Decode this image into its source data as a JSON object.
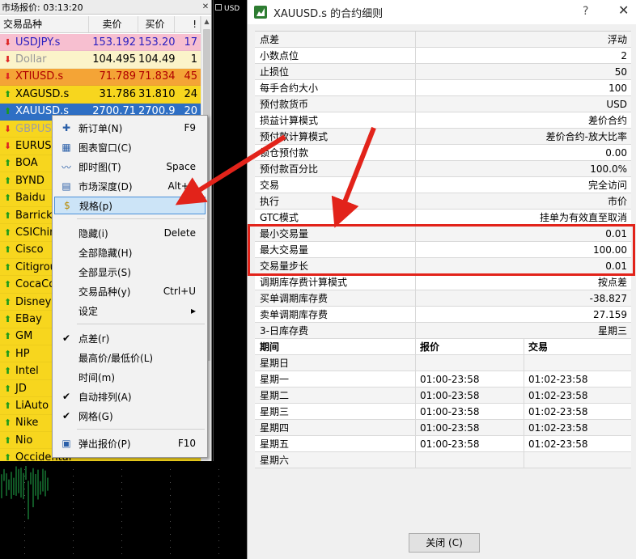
{
  "market_watch": {
    "title": "市场报价: 03:13:20",
    "close_glyph": "✕",
    "headers": {
      "symbol": "交易品种",
      "bid": "卖价",
      "ask": "买价",
      "spread": "!"
    },
    "rows": [
      {
        "symbol": "USDJPY.s",
        "bid": "153.192",
        "ask": "153.209",
        "spread": "17",
        "dir": "down",
        "bg": "#f7bfd0",
        "color": "#2a1fc0"
      },
      {
        "symbol": "Dollar",
        "bid": "104.495",
        "ask": "104.496",
        "spread": "1",
        "dir": "down",
        "bg": "#fbf3c9",
        "color": "#999999",
        "bidColor": "#000000"
      },
      {
        "symbol": "XTIUSD.s",
        "bid": "71.789",
        "ask": "71.834",
        "spread": "45",
        "dir": "down",
        "bg": "#f4a436",
        "color": "#b00000"
      },
      {
        "symbol": "XAGUSD.s",
        "bid": "31.786",
        "ask": "31.810",
        "spread": "24",
        "dir": "up",
        "bg": "#f7d61e",
        "color": "#000000"
      },
      {
        "symbol": "XAUUSD.s",
        "bid": "2700.71",
        "ask": "2700.91",
        "spread": "20",
        "dir": "up",
        "bg": "#2e6fc4",
        "color": "#ffffff"
      },
      {
        "symbol": "GBPUSD.s",
        "bid": "",
        "ask": "",
        "spread": "",
        "dir": "down",
        "bg": "#f7d61e",
        "color": "#a0a0a0"
      },
      {
        "symbol": "EURUSD.s",
        "bid": "",
        "ask": "",
        "spread": "",
        "dir": "down",
        "bg": "#f7d61e",
        "color": "#000000"
      },
      {
        "symbol": "BOA",
        "bid": "",
        "ask": "",
        "spread": "",
        "dir": "up",
        "bg": "#f7d61e",
        "color": "#000000"
      },
      {
        "symbol": "BYND",
        "bid": "",
        "ask": "",
        "spread": "",
        "dir": "up",
        "bg": "#f7d61e",
        "color": "#000000"
      },
      {
        "symbol": "Baidu",
        "bid": "",
        "ask": "",
        "spread": "",
        "dir": "up",
        "bg": "#f7d61e",
        "color": "#000000"
      },
      {
        "symbol": "Barrick",
        "bid": "",
        "ask": "",
        "spread": "",
        "dir": "up",
        "bg": "#f7d61e",
        "color": "#000000"
      },
      {
        "symbol": "CSIChina",
        "bid": "",
        "ask": "",
        "spread": "",
        "dir": "up",
        "bg": "#f7d61e",
        "color": "#000000"
      },
      {
        "symbol": "Cisco",
        "bid": "",
        "ask": "",
        "spread": "",
        "dir": "up",
        "bg": "#f7d61e",
        "color": "#000000"
      },
      {
        "symbol": "Citigroup",
        "bid": "",
        "ask": "",
        "spread": "",
        "dir": "up",
        "bg": "#f7d61e",
        "color": "#000000"
      },
      {
        "symbol": "CocaCola",
        "bid": "",
        "ask": "",
        "spread": "",
        "dir": "up",
        "bg": "#f7d61e",
        "color": "#000000"
      },
      {
        "symbol": "Disney",
        "bid": "",
        "ask": "",
        "spread": "",
        "dir": "up",
        "bg": "#f7d61e",
        "color": "#000000"
      },
      {
        "symbol": "EBay",
        "bid": "",
        "ask": "",
        "spread": "",
        "dir": "up",
        "bg": "#f7d61e",
        "color": "#000000"
      },
      {
        "symbol": "GM",
        "bid": "",
        "ask": "",
        "spread": "",
        "dir": "up",
        "bg": "#f7d61e",
        "color": "#000000"
      },
      {
        "symbol": "HP",
        "bid": "",
        "ask": "",
        "spread": "",
        "dir": "up",
        "bg": "#f7d61e",
        "color": "#000000"
      },
      {
        "symbol": "Intel",
        "bid": "",
        "ask": "",
        "spread": "",
        "dir": "up",
        "bg": "#f7d61e",
        "color": "#000000"
      },
      {
        "symbol": "JD",
        "bid": "",
        "ask": "",
        "spread": "",
        "dir": "up",
        "bg": "#f7d61e",
        "color": "#000000"
      },
      {
        "symbol": "LiAuto",
        "bid": "",
        "ask": "",
        "spread": "",
        "dir": "up",
        "bg": "#f7d61e",
        "color": "#000000"
      },
      {
        "symbol": "Nike",
        "bid": "",
        "ask": "",
        "spread": "",
        "dir": "up",
        "bg": "#f7d61e",
        "color": "#000000"
      },
      {
        "symbol": "Nio",
        "bid": "",
        "ask": "",
        "spread": "",
        "dir": "up",
        "bg": "#f7d61e",
        "color": "#000000"
      },
      {
        "symbol": "Occidental",
        "bid": "",
        "ask": "",
        "spread": "",
        "dir": "up",
        "bg": "#f7d61e",
        "color": "#000000"
      }
    ]
  },
  "chart": {
    "label": "USD"
  },
  "context_menu": {
    "items": [
      {
        "label": "新订单(N)",
        "shortcut": "F9",
        "icon": "new-order-icon",
        "glyph": "✚"
      },
      {
        "label": "图表窗口(C)",
        "shortcut": "",
        "icon": "chart-window-icon",
        "glyph": "▦"
      },
      {
        "label": "即时图(T)",
        "shortcut": "Space",
        "icon": "tick-chart-icon",
        "glyph": "〰"
      },
      {
        "label": "市场深度(D)",
        "shortcut": "Alt+B",
        "icon": "market-depth-icon",
        "glyph": "▤"
      },
      {
        "label": "规格(p)",
        "shortcut": "",
        "icon": "specification-icon",
        "glyph": "$",
        "highlight": true
      },
      {
        "label": "隐藏(i)",
        "shortcut": "Delete",
        "icon": "",
        "glyph": ""
      },
      {
        "label": "全部隐藏(H)",
        "shortcut": "",
        "icon": "",
        "glyph": ""
      },
      {
        "label": "全部显示(S)",
        "shortcut": "",
        "icon": "",
        "glyph": ""
      },
      {
        "label": "交易品种(y)",
        "shortcut": "Ctrl+U",
        "icon": "",
        "glyph": ""
      },
      {
        "label": "设定",
        "shortcut": "▸",
        "icon": "",
        "glyph": ""
      },
      {
        "label": "点差(r)",
        "shortcut": "",
        "icon": "check-icon",
        "glyph": "✔"
      },
      {
        "label": "最高价/最低价(L)",
        "shortcut": "",
        "icon": "",
        "glyph": ""
      },
      {
        "label": "时间(m)",
        "shortcut": "",
        "icon": "",
        "glyph": ""
      },
      {
        "label": "自动排列(A)",
        "shortcut": "",
        "icon": "check-icon",
        "glyph": "✔"
      },
      {
        "label": "网格(G)",
        "shortcut": "",
        "icon": "check-icon",
        "glyph": "✔"
      },
      {
        "label": "弹出报价(P)",
        "shortcut": "F10",
        "icon": "popup-quote-icon",
        "glyph": "▣"
      }
    ]
  },
  "dialog": {
    "title": "XAUUSD.s 的合约细则",
    "help_glyph": "?",
    "close_glyph": "✕",
    "specs": [
      {
        "key": "点差",
        "value": "浮动"
      },
      {
        "key": "小数点位",
        "value": "2"
      },
      {
        "key": "止损位",
        "value": "50"
      },
      {
        "key": "每手合约大小",
        "value": "100"
      },
      {
        "key": "预付款货币",
        "value": "USD"
      },
      {
        "key": "损益计算模式",
        "value": "差价合约"
      },
      {
        "key": "预付款计算模式",
        "value": "差价合约-放大比率"
      },
      {
        "key": "锁仓预付款",
        "value": "0.00"
      },
      {
        "key": "预付款百分比",
        "value": "100.0%"
      },
      {
        "key": "交易",
        "value": "完全访问"
      },
      {
        "key": "执行",
        "value": "市价"
      },
      {
        "key": "GTC模式",
        "value": "挂单为有效直至取消"
      },
      {
        "key": "最小交易量",
        "value": "0.01"
      },
      {
        "key": "最大交易量",
        "value": "100.00"
      },
      {
        "key": "交易量步长",
        "value": "0.01"
      },
      {
        "key": "调期库存费计算模式",
        "value": "按点差"
      },
      {
        "key": "买单调期库存费",
        "value": "-38.827"
      },
      {
        "key": "卖单调期库存费",
        "value": "27.159"
      },
      {
        "key": "3-日库存费",
        "value": "星期三"
      }
    ],
    "session_headers": {
      "period": "期间",
      "quote": "报价",
      "trade": "交易"
    },
    "sessions": [
      {
        "day": "星期日",
        "quote": "",
        "trade": ""
      },
      {
        "day": "星期一",
        "quote": "01:00-23:58",
        "trade": "01:02-23:58"
      },
      {
        "day": "星期二",
        "quote": "01:00-23:58",
        "trade": "01:02-23:58"
      },
      {
        "day": "星期三",
        "quote": "01:00-23:58",
        "trade": "01:02-23:58"
      },
      {
        "day": "星期四",
        "quote": "01:00-23:58",
        "trade": "01:02-23:58"
      },
      {
        "day": "星期五",
        "quote": "01:00-23:58",
        "trade": "01:02-23:58"
      },
      {
        "day": "星期六",
        "quote": "",
        "trade": ""
      }
    ],
    "close_button": "关闭 (C)"
  },
  "colors": {
    "highlight_box": "#e2231a",
    "arrow": "#e2231a",
    "menu_highlight": "#cce4f7",
    "chart_bars": "#22b14c"
  }
}
